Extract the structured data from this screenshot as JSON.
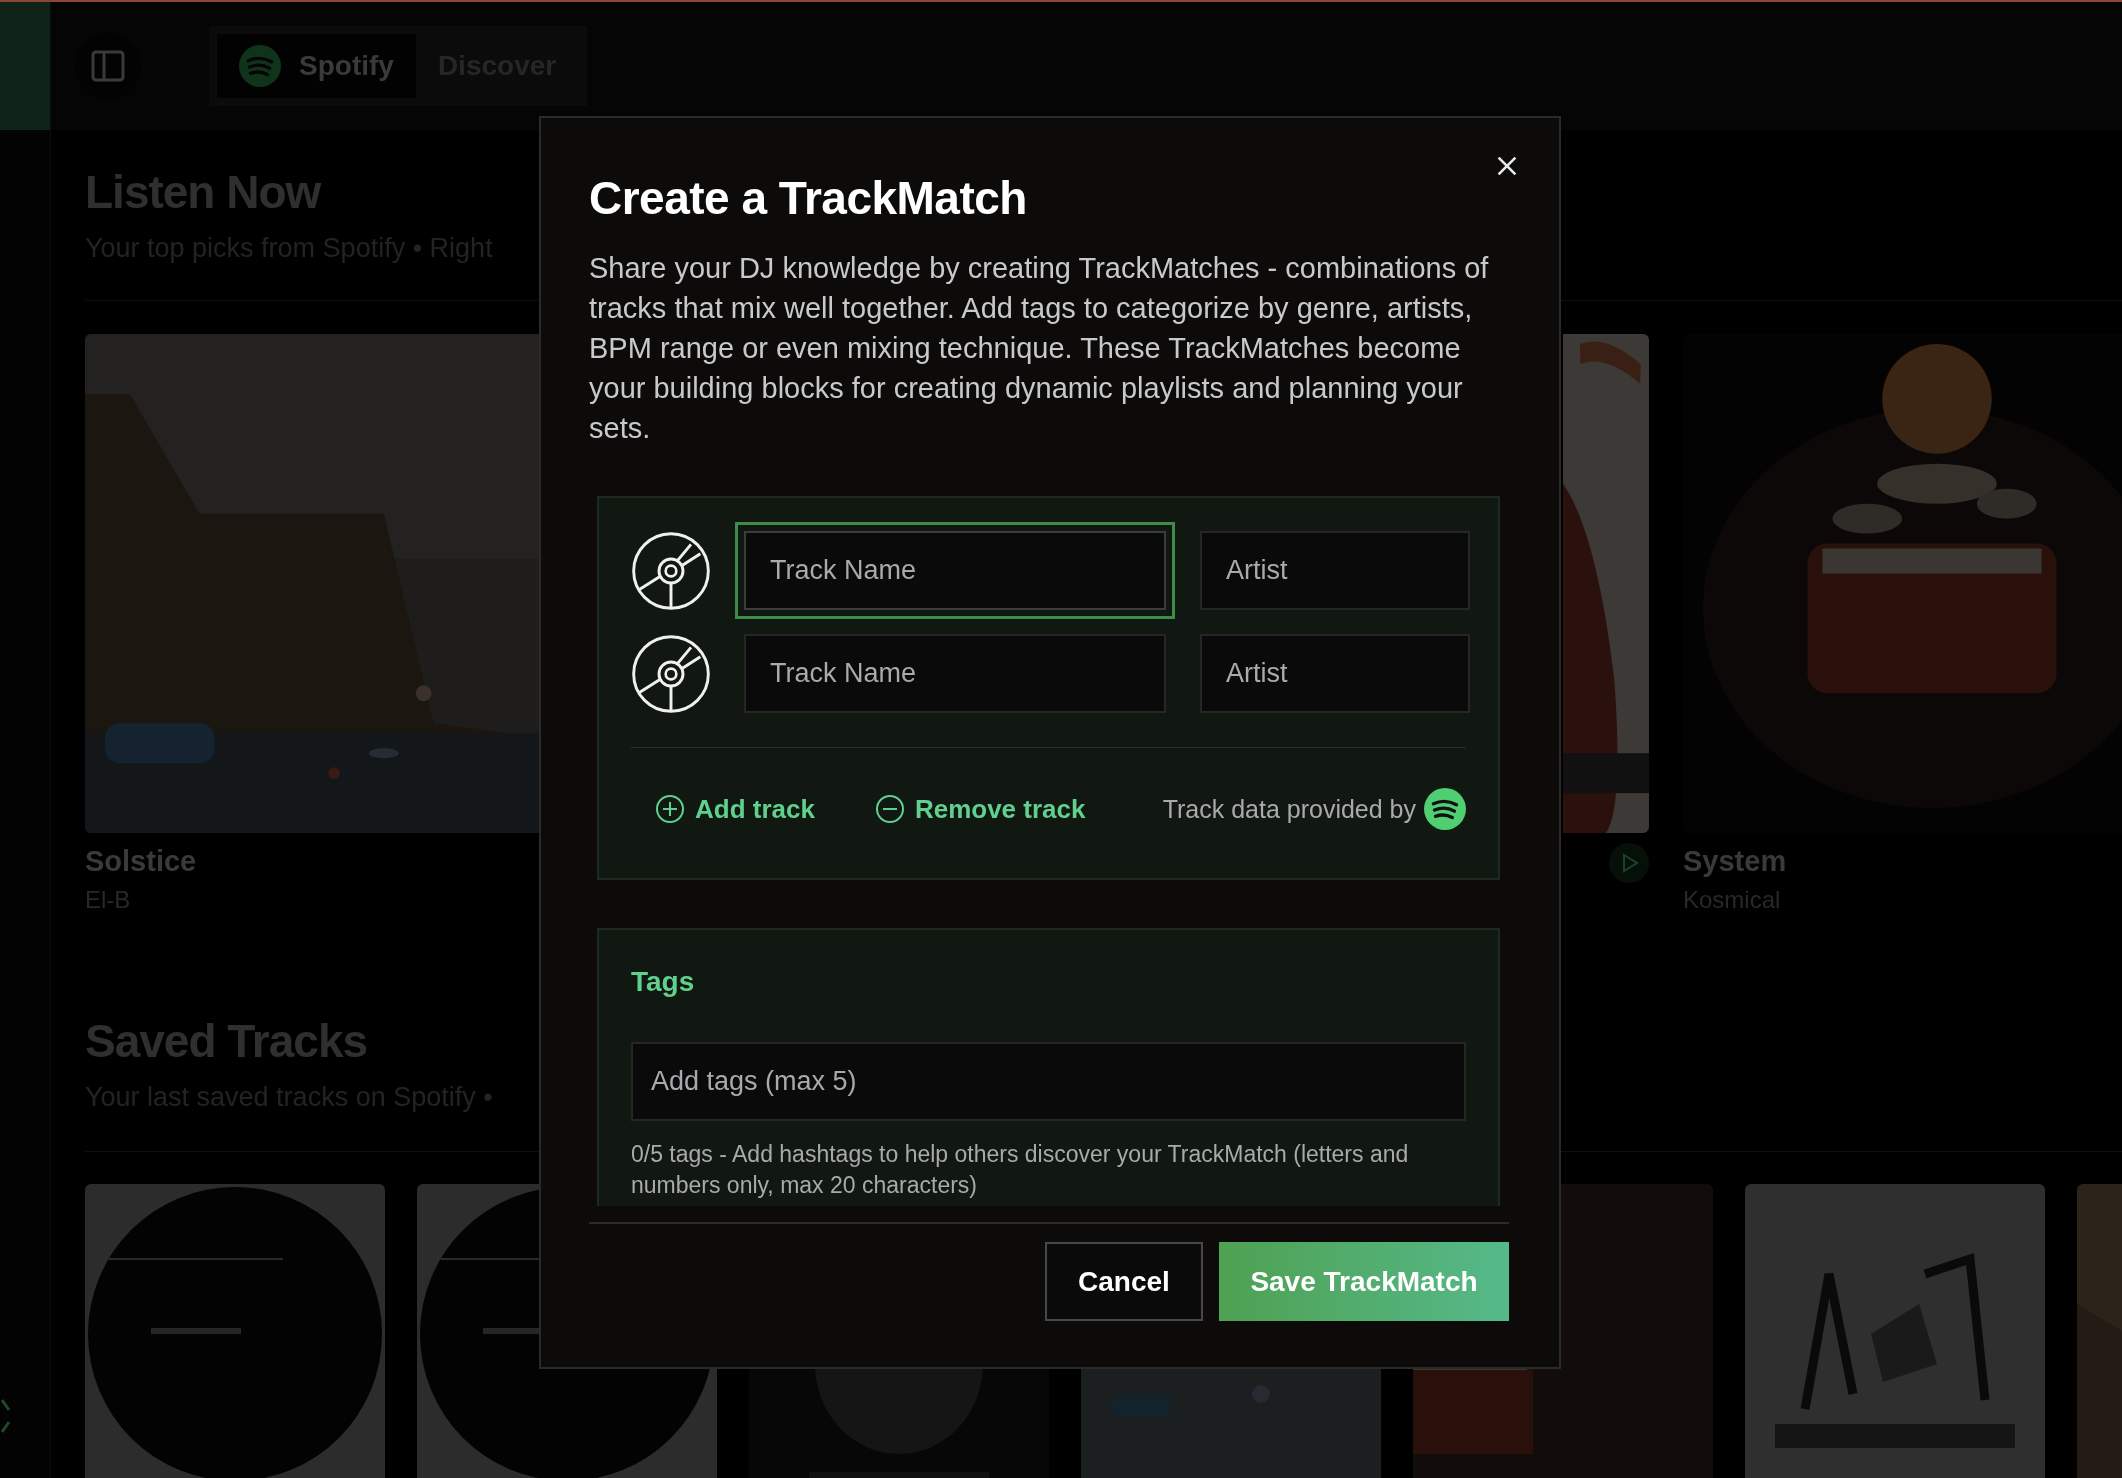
{
  "topbar": {
    "tabs": [
      {
        "label": "Spotify",
        "selected": true
      },
      {
        "label": "Discover",
        "selected": false
      }
    ]
  },
  "listen_now": {
    "title": "Listen Now",
    "subtitle": "Your top picks from Spotify • Right",
    "cards": [
      {
        "kind": "full",
        "title": "Solstice",
        "artist": "El-B"
      },
      {
        "kind": "partial"
      },
      {
        "kind": "full",
        "title": "System",
        "artist": "Kosmical"
      }
    ]
  },
  "saved_tracks": {
    "title": "Saved Tracks",
    "subtitle": "Your last saved tracks on Spotify •"
  },
  "dialog": {
    "title": "Create a TrackMatch",
    "description": "Share your DJ knowledge by creating TrackMatches - combinations of tracks that mix well together. Add tags to categorize by genre, artists, BPM range or even mixing technique. These TrackMatches become your building blocks for creating dynamic playlists and planning your sets.",
    "tracks": [
      {
        "track_placeholder": "Track Name",
        "artist_placeholder": "Artist",
        "focused": true
      },
      {
        "track_placeholder": "Track Name",
        "artist_placeholder": "Artist",
        "focused": false
      }
    ],
    "add_label": "Add track",
    "remove_label": "Remove track",
    "attribution": "Track data provided by",
    "tags": {
      "label": "Tags",
      "placeholder": "Add tags (max 5)",
      "help": "0/5 tags - Add hashtags to help others discover your TrackMatch (letters and numbers only, max 20 characters)"
    },
    "buttons": [
      {
        "label": "Cancel",
        "kind": "secondary"
      },
      {
        "label": "Save TrackMatch",
        "kind": "primary"
      }
    ]
  }
}
